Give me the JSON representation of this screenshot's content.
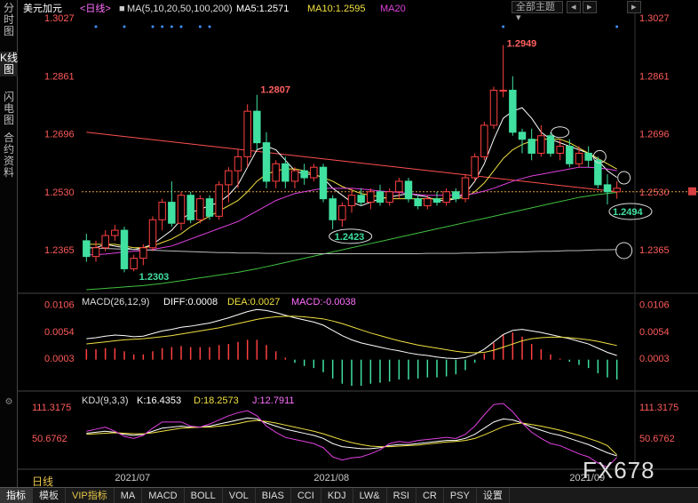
{
  "sidebar": {
    "tabs": [
      {
        "label": "分时图",
        "active": false
      },
      {
        "label": "K线图",
        "active": true
      },
      {
        "label": "闪电图",
        "active": false
      },
      {
        "label": "合约资料",
        "active": false
      }
    ]
  },
  "header": {
    "symbol": "美元加元",
    "period_tag": "<日线>",
    "ma_label": "MA(5,10,20,50,100,200)",
    "ma5": "MA5:1.2571",
    "ma10": "MA10:1.2595",
    "ma20": "MA20",
    "theme_button": "全部主题",
    "colors": {
      "ma5": "#ffffff",
      "ma10": "#f0e040",
      "ma20": "#e040e0",
      "ma50": "#40c040",
      "ma100": "#bbbbbb",
      "up": "#ff4040",
      "down": "#40e0a0",
      "trend": "#ff5050"
    }
  },
  "macd": {
    "label": "MACD(26,12,9)",
    "diff": "DIFF:0.0008",
    "dea": "DEA:0.0027",
    "macd": "MACD:-0.0038"
  },
  "kdj": {
    "label": "KDJ(9,3,3)",
    "k": "K:16.4353",
    "d": "D:18.2573",
    "j": "J:12.7911"
  },
  "price_axis": [
    "1.3027",
    "1.2861",
    "1.2696",
    "1.2530",
    "1.2365"
  ],
  "macd_axis": [
    "0.0106",
    "0.0054",
    "0.0003"
  ],
  "kdj_axis": [
    "111.3175",
    "50.6762"
  ],
  "date_axis": [
    "2021/07",
    "2021/08",
    "2021/09"
  ],
  "annotations": {
    "high1": "1.2807",
    "low1": "1.2303",
    "low2": "1.2423",
    "high2": "1.2949",
    "last_low": "1.2494"
  },
  "bottom_toolbar": {
    "period": "日线",
    "items": [
      "指标",
      "模板",
      "VIP指标",
      "MA",
      "MACD",
      "BOLL",
      "VOL",
      "BIAS",
      "CCI",
      "KDJ",
      "LW&",
      "RSI",
      "CR",
      "PSY",
      "设置"
    ]
  },
  "watermark": "FX678",
  "chart_data": [
    {
      "type": "candlestick",
      "title": "美元加元 日线",
      "ylim": [
        1.224,
        1.3027
      ],
      "ohlc": [
        [
          1.239,
          1.241,
          1.233,
          1.2345
        ],
        [
          1.2345,
          1.239,
          1.233,
          1.237
        ],
        [
          1.237,
          1.242,
          1.236,
          1.2405
        ],
        [
          1.2405,
          1.2435,
          1.239,
          1.242
        ],
        [
          1.242,
          1.243,
          1.23,
          1.231
        ],
        [
          1.231,
          1.235,
          1.2303,
          1.234
        ],
        [
          1.234,
          1.238,
          1.232,
          1.237
        ],
        [
          1.237,
          1.246,
          1.236,
          1.245
        ],
        [
          1.245,
          1.251,
          1.242,
          1.25
        ],
        [
          1.25,
          1.256,
          1.243,
          1.244
        ],
        [
          1.244,
          1.253,
          1.242,
          1.252
        ],
        [
          1.252,
          1.253,
          1.244,
          1.245
        ],
        [
          1.245,
          1.252,
          1.244,
          1.251
        ],
        [
          1.251,
          1.252,
          1.245,
          1.246
        ],
        [
          1.246,
          1.256,
          1.245,
          1.255
        ],
        [
          1.255,
          1.26,
          1.25,
          1.259
        ],
        [
          1.259,
          1.265,
          1.254,
          1.263
        ],
        [
          1.263,
          1.278,
          1.26,
          1.276
        ],
        [
          1.276,
          1.2807,
          1.265,
          1.267
        ],
        [
          1.267,
          1.27,
          1.254,
          1.256
        ],
        [
          1.256,
          1.262,
          1.254,
          1.261
        ],
        [
          1.261,
          1.263,
          1.254,
          1.256
        ],
        [
          1.256,
          1.26,
          1.254,
          1.259
        ],
        [
          1.259,
          1.261,
          1.255,
          1.257
        ],
        [
          1.257,
          1.261,
          1.256,
          1.26
        ],
        [
          1.26,
          1.261,
          1.25,
          1.251
        ],
        [
          1.251,
          1.252,
          1.2423,
          1.245
        ],
        [
          1.245,
          1.25,
          1.243,
          1.249
        ],
        [
          1.249,
          1.254,
          1.247,
          1.252
        ],
        [
          1.252,
          1.254,
          1.249,
          1.25
        ],
        [
          1.25,
          1.254,
          1.248,
          1.253
        ],
        [
          1.253,
          1.255,
          1.249,
          1.25
        ],
        [
          1.25,
          1.254,
          1.249,
          1.253
        ],
        [
          1.253,
          1.257,
          1.251,
          1.256
        ],
        [
          1.256,
          1.257,
          1.25,
          1.251
        ],
        [
          1.251,
          1.252,
          1.248,
          1.249
        ],
        [
          1.249,
          1.252,
          1.248,
          1.251
        ],
        [
          1.251,
          1.253,
          1.249,
          1.25
        ],
        [
          1.25,
          1.254,
          1.249,
          1.253
        ],
        [
          1.253,
          1.254,
          1.25,
          1.251
        ],
        [
          1.251,
          1.258,
          1.25,
          1.257
        ],
        [
          1.257,
          1.264,
          1.256,
          1.263
        ],
        [
          1.263,
          1.273,
          1.262,
          1.272
        ],
        [
          1.272,
          1.283,
          1.271,
          1.282
        ],
        [
          1.282,
          1.2949,
          1.28,
          1.282
        ],
        [
          1.282,
          1.286,
          1.269,
          1.27
        ],
        [
          1.27,
          1.271,
          1.264,
          1.268
        ],
        [
          1.268,
          1.271,
          1.262,
          1.264
        ],
        [
          1.264,
          1.272,
          1.263,
          1.269
        ],
        [
          1.269,
          1.27,
          1.263,
          1.264
        ],
        [
          1.264,
          1.268,
          1.262,
          1.266
        ],
        [
          1.266,
          1.268,
          1.26,
          1.261
        ],
        [
          1.261,
          1.266,
          1.26,
          1.264
        ],
        [
          1.264,
          1.266,
          1.26,
          1.262
        ],
        [
          1.262,
          1.263,
          1.254,
          1.255
        ],
        [
          1.255,
          1.258,
          1.2494,
          1.253
        ],
        [
          1.253,
          1.256,
          1.251,
          1.254
        ]
      ],
      "ma_lines": {
        "MA5": [
          1.237,
          1.237,
          1.238,
          1.2375,
          1.237,
          1.2365,
          1.237,
          1.238,
          1.24,
          1.242,
          1.245,
          1.247,
          1.248,
          1.249,
          1.25,
          1.252,
          1.255,
          1.26,
          1.265,
          1.266,
          1.265,
          1.262,
          1.259,
          1.258,
          1.258,
          1.257,
          1.254,
          1.252,
          1.25,
          1.249,
          1.25,
          1.251,
          1.2515,
          1.252,
          1.2525,
          1.252,
          1.2515,
          1.2505,
          1.2505,
          1.251,
          1.2525,
          1.256,
          1.261,
          1.268,
          1.274,
          1.276,
          1.277,
          1.274,
          1.27,
          1.268,
          1.267,
          1.266,
          1.265,
          1.264,
          1.262,
          1.259,
          1.2571
        ],
        "MA10": [
          1.238,
          1.238,
          1.238,
          1.238,
          1.2375,
          1.237,
          1.237,
          1.2375,
          1.2385,
          1.2395,
          1.241,
          1.243,
          1.2445,
          1.246,
          1.2475,
          1.249,
          1.2505,
          1.253,
          1.256,
          1.258,
          1.259,
          1.2595,
          1.2595,
          1.259,
          1.258,
          1.257,
          1.256,
          1.2545,
          1.2535,
          1.2525,
          1.252,
          1.2515,
          1.251,
          1.251,
          1.251,
          1.251,
          1.251,
          1.251,
          1.251,
          1.251,
          1.2515,
          1.253,
          1.2555,
          1.259,
          1.2625,
          1.265,
          1.2665,
          1.2675,
          1.268,
          1.268,
          1.268,
          1.267,
          1.2655,
          1.264,
          1.2625,
          1.261,
          1.2595
        ],
        "MA20": [
          1.235,
          1.235,
          1.2352,
          1.2355,
          1.2358,
          1.236,
          1.2362,
          1.2365,
          1.237,
          1.2375,
          1.2385,
          1.2395,
          1.2405,
          1.2415,
          1.2425,
          1.2435,
          1.2445,
          1.246,
          1.2475,
          1.249,
          1.2505,
          1.2515,
          1.2525,
          1.253,
          1.2535,
          1.254,
          1.254,
          1.254,
          1.254,
          1.2538,
          1.2535,
          1.2532,
          1.253,
          1.2528,
          1.2525,
          1.2522,
          1.252,
          1.252,
          1.252,
          1.252,
          1.2522,
          1.2525,
          1.2532,
          1.254,
          1.255,
          1.256,
          1.2568,
          1.2575,
          1.258,
          1.2585,
          1.259,
          1.2595,
          1.26,
          1.26,
          1.2598,
          1.2595,
          1.259
        ],
        "MA50": [
          1.225,
          1.2252,
          1.2254,
          1.2256,
          1.2258,
          1.226,
          1.2262,
          1.2265,
          1.2268,
          1.2272,
          1.2276,
          1.228,
          1.2284,
          1.2288,
          1.2292,
          1.2296,
          1.23,
          1.2305,
          1.231,
          1.2316,
          1.2322,
          1.2328,
          1.2334,
          1.234,
          1.2346,
          1.2352,
          1.2358,
          1.2364,
          1.237,
          1.2376,
          1.2382,
          1.2388,
          1.2394,
          1.24,
          1.2406,
          1.2412,
          1.2418,
          1.2424,
          1.243,
          1.2436,
          1.2442,
          1.2448,
          1.2454,
          1.246,
          1.2466,
          1.2472,
          1.2478,
          1.2484,
          1.249,
          1.2496,
          1.2502,
          1.2508,
          1.2514,
          1.2518,
          1.2522,
          1.2525,
          1.2528
        ],
        "MA100": [
          1.237,
          1.2369,
          1.2368,
          1.2367,
          1.2366,
          1.2365,
          1.2364,
          1.2363,
          1.2362,
          1.2361,
          1.236,
          1.2359,
          1.2358,
          1.2357,
          1.2356,
          1.2356,
          1.2355,
          1.2355,
          1.2355,
          1.2354,
          1.2354,
          1.2354,
          1.2354,
          1.2354,
          1.2353,
          1.2353,
          1.2353,
          1.2353,
          1.2353,
          1.2353,
          1.2353,
          1.2353,
          1.2353,
          1.2353,
          1.2353,
          1.2353,
          1.2354,
          1.2354,
          1.2354,
          1.2354,
          1.2355,
          1.2355,
          1.2356,
          1.2356,
          1.2357,
          1.2358,
          1.2358,
          1.2359,
          1.236,
          1.236,
          1.2361,
          1.2362,
          1.2362,
          1.2363,
          1.2364,
          1.2364,
          1.2365
        ]
      },
      "trend_line": [
        [
          0,
          1.27
        ],
        [
          56,
          1.253
        ]
      ]
    },
    {
      "type": "line",
      "title": "MACD(26,12,9)",
      "ylim": [
        -0.006,
        0.011
      ],
      "series": [
        {
          "name": "DIFF",
          "values": [
            0.004,
            0.0042,
            0.0045,
            0.0047,
            0.0046,
            0.0044,
            0.0045,
            0.005,
            0.0055,
            0.0058,
            0.0062,
            0.0064,
            0.0067,
            0.007,
            0.0075,
            0.008,
            0.0086,
            0.0092,
            0.0096,
            0.0094,
            0.009,
            0.0085,
            0.008,
            0.0076,
            0.0072,
            0.0066,
            0.0056,
            0.0046,
            0.0038,
            0.0032,
            0.0028,
            0.0024,
            0.002,
            0.0017,
            0.0013,
            0.001,
            0.0008,
            0.0005,
            0.0003,
            0.0002,
            0.0004,
            0.001,
            0.002,
            0.0034,
            0.0048,
            0.0056,
            0.0058,
            0.0055,
            0.0052,
            0.0048,
            0.0044,
            0.004,
            0.0035,
            0.003,
            0.0022,
            0.0014,
            0.0008
          ]
        },
        {
          "name": "DEA",
          "values": [
            0.003,
            0.0032,
            0.0034,
            0.0036,
            0.0038,
            0.0039,
            0.004,
            0.0042,
            0.0044,
            0.0046,
            0.0049,
            0.0052,
            0.0055,
            0.0058,
            0.0061,
            0.0065,
            0.0069,
            0.0073,
            0.0077,
            0.008,
            0.0082,
            0.0083,
            0.0083,
            0.0082,
            0.008,
            0.0078,
            0.0074,
            0.0069,
            0.0063,
            0.0057,
            0.0051,
            0.0046,
            0.0041,
            0.0036,
            0.0032,
            0.0028,
            0.0025,
            0.0022,
            0.0019,
            0.0016,
            0.0014,
            0.0013,
            0.0014,
            0.0018,
            0.0024,
            0.003,
            0.0036,
            0.004,
            0.0042,
            0.0043,
            0.0043,
            0.0042,
            0.004,
            0.0038,
            0.0035,
            0.0031,
            0.0027
          ]
        }
      ],
      "histogram": [
        0.002,
        0.002,
        0.0022,
        0.0022,
        0.0016,
        0.001,
        0.001,
        0.0016,
        0.0022,
        0.0024,
        0.0026,
        0.0024,
        0.0024,
        0.0024,
        0.0028,
        0.003,
        0.0034,
        0.0038,
        0.0038,
        0.0028,
        0.0016,
        0.0004,
        -0.0006,
        -0.0012,
        -0.0016,
        -0.0024,
        -0.0036,
        -0.0046,
        -0.005,
        -0.005,
        -0.0046,
        -0.0044,
        -0.0042,
        -0.0038,
        -0.0038,
        -0.0036,
        -0.0034,
        -0.0034,
        -0.0032,
        -0.0028,
        -0.002,
        -0.0006,
        0.0012,
        0.0032,
        0.0048,
        0.0052,
        0.0044,
        0.003,
        0.002,
        0.001,
        0.0002,
        -0.0004,
        -0.001,
        -0.0016,
        -0.0026,
        -0.0034,
        -0.0038
      ]
    },
    {
      "type": "line",
      "title": "KDJ(9,3,3)",
      "ylim": [
        -10,
        125
      ],
      "series": [
        {
          "name": "K",
          "values": [
            60,
            62,
            64,
            62,
            58,
            56,
            58,
            64,
            70,
            72,
            74,
            72,
            72,
            74,
            78,
            82,
            86,
            90,
            88,
            80,
            74,
            68,
            64,
            60,
            56,
            50,
            40,
            34,
            32,
            30,
            30,
            32,
            36,
            38,
            38,
            40,
            42,
            44,
            46,
            46,
            50,
            58,
            70,
            82,
            88,
            86,
            80,
            72,
            66,
            60,
            56,
            50,
            44,
            38,
            30,
            22,
            16
          ]
        },
        {
          "name": "D",
          "values": [
            58,
            59,
            60,
            61,
            60,
            59,
            59,
            61,
            64,
            67,
            70,
            71,
            72,
            72,
            74,
            76,
            79,
            83,
            85,
            83,
            80,
            76,
            72,
            68,
            64,
            59,
            53,
            47,
            42,
            38,
            35,
            34,
            34,
            35,
            36,
            37,
            39,
            41,
            43,
            44,
            46,
            50,
            57,
            65,
            73,
            78,
            80,
            77,
            74,
            70,
            66,
            61,
            56,
            50,
            44,
            36,
            18
          ]
        },
        {
          "name": "J",
          "values": [
            64,
            68,
            72,
            64,
            54,
            50,
            56,
            70,
            82,
            82,
            82,
            74,
            72,
            78,
            86,
            94,
            100,
            104,
            94,
            74,
            62,
            52,
            48,
            44,
            40,
            32,
            14,
            8,
            12,
            14,
            20,
            28,
            40,
            44,
            42,
            46,
            48,
            50,
            52,
            50,
            58,
            74,
            96,
            116,
            118,
            102,
            80,
            62,
            50,
            40,
            36,
            28,
            20,
            14,
            2,
            -6,
            13
          ]
        }
      ]
    }
  ]
}
